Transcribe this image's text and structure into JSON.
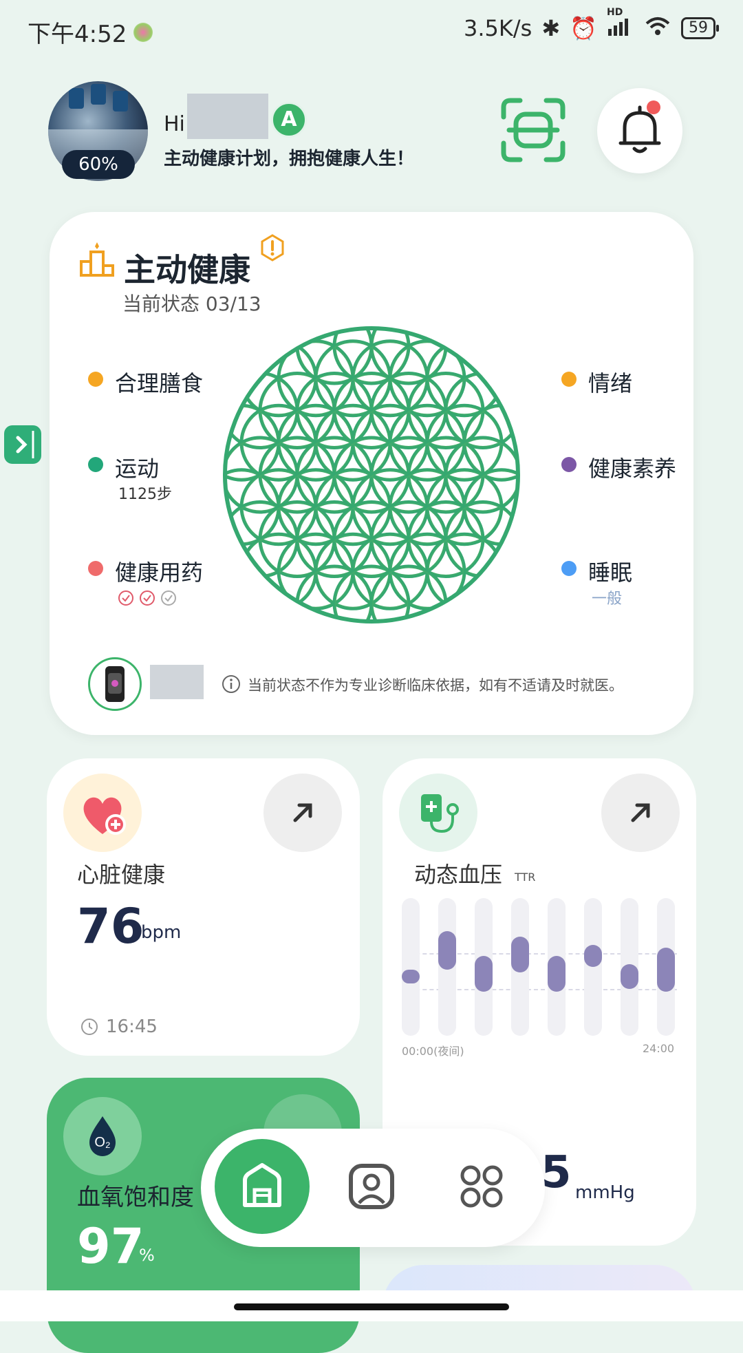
{
  "status_bar": {
    "time": "下午4:52",
    "net_speed": "3.5K/s",
    "hd": "HD",
    "battery": "59"
  },
  "header": {
    "avatar_progress": "60%",
    "greeting": "Hi",
    "level_badge": "A",
    "slogan": "主动健康计划，拥抱健康人生！"
  },
  "health_card": {
    "title": "主动健康",
    "subtitle": "当前状态 03/13",
    "left_items": [
      {
        "label": "合理膳食",
        "color": "#f5a623"
      },
      {
        "label": "运动",
        "sub": "1125步",
        "color": "#22a77a"
      },
      {
        "label": "健康用药",
        "color": "#ef6b6b"
      }
    ],
    "right_items": [
      {
        "label": "情绪",
        "color": "#f5a623"
      },
      {
        "label": "健康素养",
        "color": "#7c57a6"
      },
      {
        "label": "睡眠",
        "sub": "一般",
        "color": "#4d9df5"
      }
    ],
    "disclaimer": "当前状态不作为专业诊断临床依据，如有不适请及时就医。"
  },
  "heart_card": {
    "title": "心脏健康",
    "value": "76",
    "unit": "bpm",
    "time": "16:45"
  },
  "bp_card": {
    "title": "动态血压",
    "title_tag": "TTR",
    "axis_start": "00:00(夜间)",
    "axis_end": "24:00",
    "value_partial": "5",
    "unit": "mmHg"
  },
  "oxygen_card": {
    "title": "血氧饱和度",
    "value": "97",
    "unit": "%",
    "icon_text": "O₂"
  }
}
